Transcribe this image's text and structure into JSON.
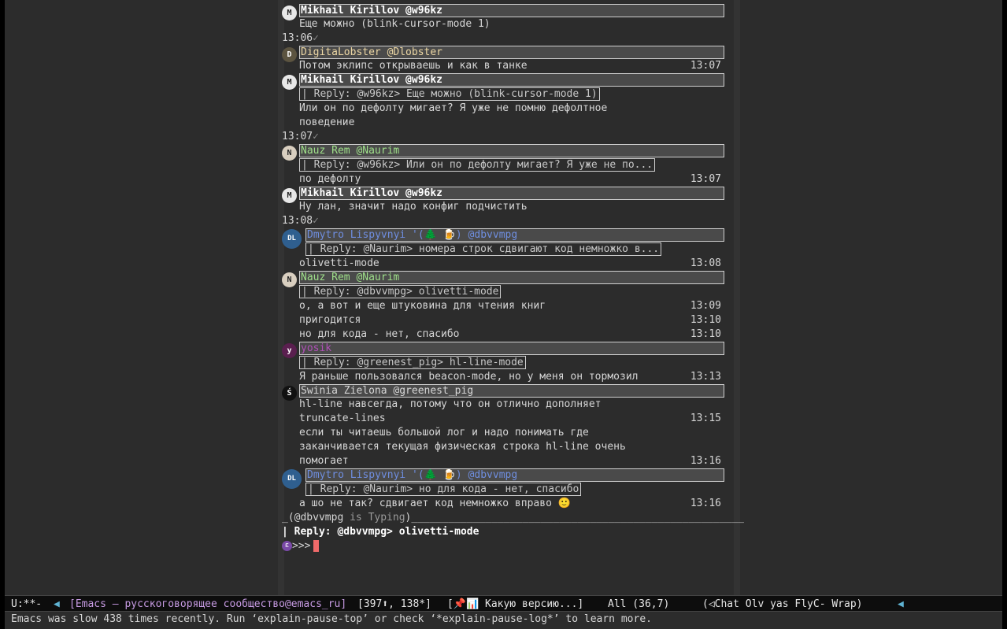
{
  "colors": {
    "background": "#2c2c2c",
    "header_box": "#4a4a4a",
    "name_bold": "#ffffff",
    "name_green": "#9fe08a",
    "name_blue": "#6f8ee0",
    "name_purple": "#b050b8",
    "name_orange": "#ecd7a4",
    "cursor": "#f06a6a"
  },
  "messages": [
    {
      "avatar": "M",
      "avatar_color": "#e8e8e8",
      "name_color": "#ffffff",
      "bold": true,
      "sender": "Mikhail Kirillov @w96kz",
      "reply": "",
      "lines": [
        {
          "text": "Еще можно (blink-cursor-mode 1)",
          "time": ""
        }
      ],
      "stamp": "13:06",
      "check": "✓"
    },
    {
      "avatar": "D",
      "avatar_color": "#5c5440",
      "name_color": "#ecd7a4",
      "bold": false,
      "sender": "DigitaLobster @Dlobster",
      "reply": "",
      "lines": [
        {
          "text": "Потом эклипс открываешь и как в танке",
          "time": "13:07"
        }
      ],
      "stamp": "",
      "check": ""
    },
    {
      "avatar": "M",
      "avatar_color": "#e8e8e8",
      "name_color": "#ffffff",
      "bold": true,
      "sender": "Mikhail Kirillov @w96kz",
      "reply": "| Reply: @w96kz> Еще можно (blink-cursor-mode 1)",
      "lines": [
        {
          "text": "Или он по дефолту мигает? Я уже не помню дефолтное",
          "time": ""
        },
        {
          "text": "поведение",
          "time": ""
        }
      ],
      "stamp": "13:07",
      "check": "✓"
    },
    {
      "avatar": "N",
      "avatar_color": "#d9cfc0",
      "name_color": "#9fe08a",
      "bold": false,
      "sender": "Nauz Rem @Naurim",
      "reply": "| Reply: @w96kz> Или он по дефолту мигает? Я уже не по...",
      "lines": [
        {
          "text": "по дефолту",
          "time": "13:07"
        }
      ],
      "stamp": "",
      "check": ""
    },
    {
      "avatar": "M",
      "avatar_color": "#e8e8e8",
      "name_color": "#ffffff",
      "bold": true,
      "sender": "Mikhail Kirillov @w96kz",
      "reply": "",
      "lines": [
        {
          "text": "Ну лан, значит надо конфиг подчистить",
          "time": ""
        }
      ],
      "stamp": "13:08",
      "check": "✓"
    },
    {
      "avatar": "DL",
      "avatar_color": "#2f5f8f",
      "name_color": "#6f8ee0",
      "bold": false,
      "tall": true,
      "sender": "Dmytro Lispyvnyi '(🌲 🍺) @dbvvmpg",
      "reply": "| Reply: @Naurim> номера строк сдвигают код немножко в...",
      "lines": [
        {
          "text": "olivetti-mode",
          "time": "13:08"
        }
      ],
      "stamp": "",
      "check": ""
    },
    {
      "avatar": "N",
      "avatar_color": "#d9cfc0",
      "name_color": "#9fe08a",
      "bold": false,
      "sender": "Nauz Rem @Naurim",
      "reply": "| Reply: @dbvvmpg> olivetti-mode",
      "lines": [
        {
          "text": "о, а вот и еще штуковина для чтения книг",
          "time": "13:09"
        },
        {
          "text": "пригодится",
          "time": "13:10"
        },
        {
          "text": "но для кода - нет, спасибо",
          "time": "13:10"
        }
      ],
      "stamp": "",
      "check": ""
    },
    {
      "avatar": "y",
      "avatar_color": "#5a1f4f",
      "name_color": "#b050b8",
      "bold": false,
      "sender": "yosik",
      "reply": "| Reply: @greenest_pig> hl-line-mode",
      "lines": [
        {
          "text": "Я раньше пользовался beacon-mode, но у меня он тормозил",
          "time": "13:13"
        }
      ],
      "stamp": "",
      "check": ""
    },
    {
      "avatar": "Ś",
      "avatar_color": "#111111",
      "name_color": "#d6d6d6",
      "bold": false,
      "sender": "Świnia Zielona @greenest_pig",
      "reply": "",
      "lines": [
        {
          "text": "hl-line навсегда, потому что он отлично дополняет",
          "time": ""
        },
        {
          "text": "truncate-lines",
          "time": "13:15"
        },
        {
          "text": "если ты читаешь большой лог и надо понимать где",
          "time": ""
        },
        {
          "text": "заканчивается текущая физическая строка hl-line очень",
          "time": ""
        },
        {
          "text": "помогает",
          "time": "13:16"
        }
      ],
      "stamp": "",
      "check": ""
    },
    {
      "avatar": "DL",
      "avatar_color": "#2f5f8f",
      "name_color": "#6f8ee0",
      "bold": false,
      "tall": true,
      "sender": "Dmytro Lispyvnyi '(🌲 🍺) @dbvvmpg",
      "reply": "| Reply: @Naurim> но для кода - нет, спасибо",
      "lines": [
        {
          "text": "а шо не так? сдвигает код немножко вправо 🙂",
          "time": "13:16"
        }
      ],
      "stamp": "",
      "check": ""
    }
  ],
  "typing": {
    "prefix": "_(@dbvvmpg ",
    "status": "is Typing",
    "suffix": ")______________________________________________________"
  },
  "compose": {
    "reply_label": "| Reply: @dbvvmpg> olivetti-mode",
    "prompt": ">>>",
    "prompt_icon": "emacs-icon"
  },
  "modeline": {
    "state": "U:**-",
    "buffer": "[Emacs — русскоговорящее сообщество@emacs_ru]",
    "counts": "[397⬆, 138*]",
    "pinned": "[📌📊 Какую версию...]",
    "position": "All (36,7)",
    "modes": "(◁Chat Olv yas FlyC- Wrap)"
  },
  "echo": "Emacs was slow 438 times recently. Run ‘explain-pause-top’ or check ‘*explain-pause-log*’ to learn more."
}
